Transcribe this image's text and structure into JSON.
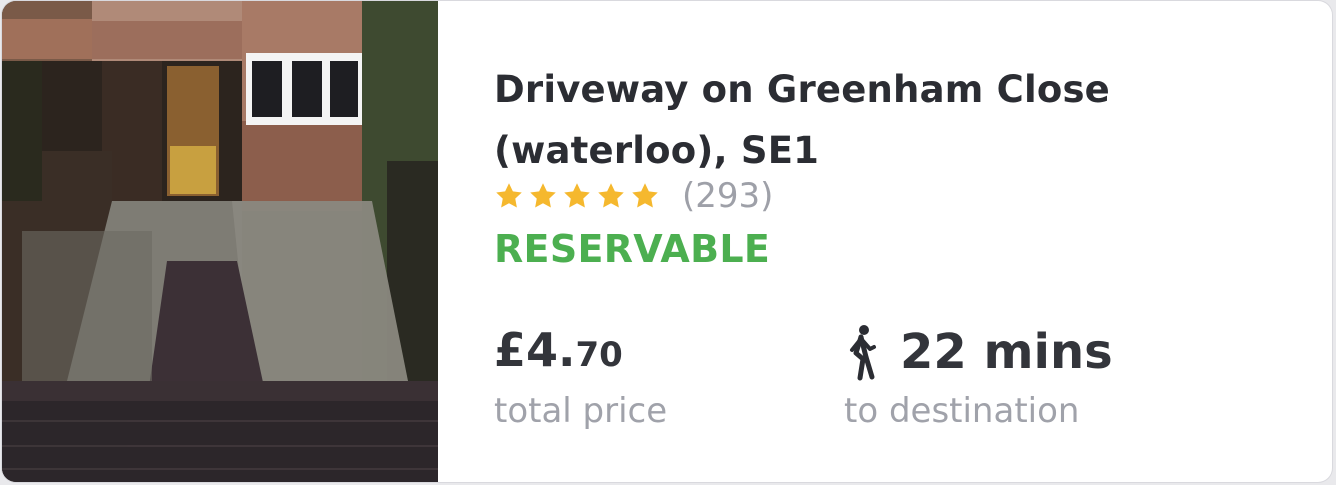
{
  "listing": {
    "title_line1": "Driveway on Greenham Close",
    "title_line2": "(waterloo), SE1",
    "rating": 5,
    "rating_max": 5,
    "review_count": "(293)",
    "status": "RESERVABLE",
    "price_pounds": "£4.",
    "price_pence": "70",
    "price_label": "total price",
    "walk_time": "22 mins",
    "walk_label": "to destination"
  },
  "icons": {
    "walk": "walking-person-icon",
    "star": "star-icon"
  },
  "colors": {
    "status": "#4caf50",
    "star": "#f5b82e",
    "text": "#33353b",
    "muted": "#a0a2aa"
  }
}
